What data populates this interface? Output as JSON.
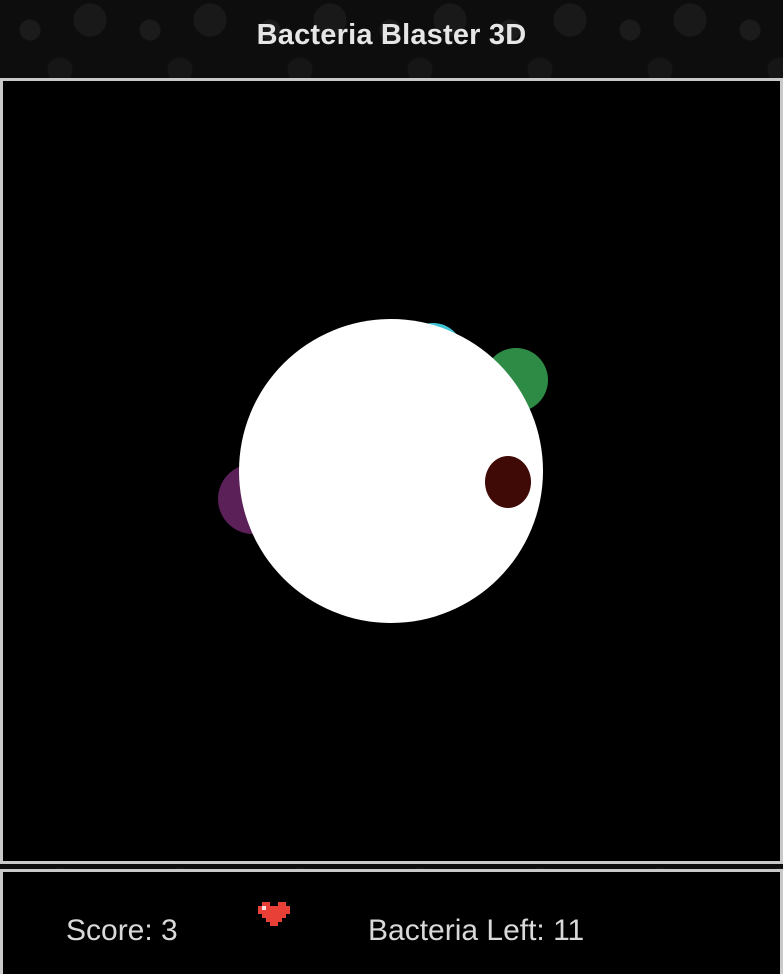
{
  "game": {
    "title": "Bacteria Blaster 3D"
  },
  "scene": {
    "sphere": {
      "color": "#ffffff"
    },
    "bacteria": [
      {
        "name": "bacterium-cyan",
        "color": "#3fc6d6"
      },
      {
        "name": "bacterium-green",
        "color": "#2e8b45"
      },
      {
        "name": "bacterium-purple",
        "color": "#5a2057"
      },
      {
        "name": "bacterium-dark-red",
        "color": "#3f0905"
      }
    ]
  },
  "hud": {
    "score_text": "Score: 3",
    "bacteria_left_text": "Bacteria Left: 11",
    "lives_icon": "heart-icon",
    "heart_color": "#e84036"
  }
}
